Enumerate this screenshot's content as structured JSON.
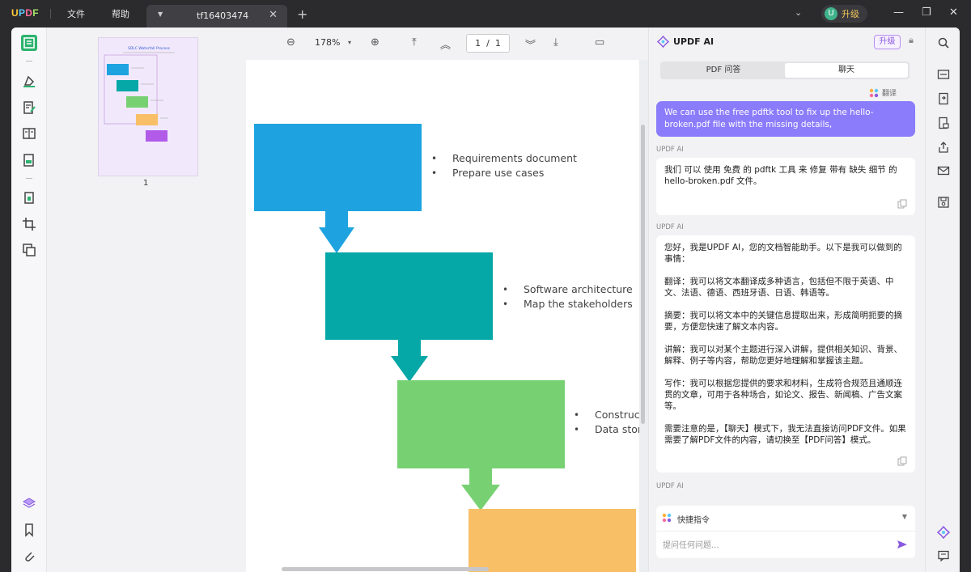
{
  "app": {
    "logo": "UPDF"
  },
  "menu": {
    "file": "文件",
    "help": "帮助"
  },
  "tab": {
    "title": "tf16403474"
  },
  "account": {
    "avatar_letter": "U",
    "upgrade": "升级"
  },
  "toolbar": {
    "zoom": "178%",
    "page_current": "1",
    "page_sep": "/",
    "page_total": "1"
  },
  "thumbnail": {
    "page_number": "1",
    "doc_title": "SDLC Waterfall Process"
  },
  "document": {
    "steps": [
      {
        "bullets": [
          "Requirements document",
          "Prepare use cases"
        ],
        "color": "#1ea3e0"
      },
      {
        "bullets": [
          "Software architecture",
          "Map the stakeholders"
        ],
        "color": "#06a7a7"
      },
      {
        "bullets": [
          "Construct",
          "Data stor"
        ],
        "color": "#77d173"
      },
      {
        "bullets": [],
        "color": "#f8bf67"
      }
    ]
  },
  "ai": {
    "title": "UPDF AI",
    "upgrade": "升级",
    "tabs": [
      {
        "label": "PDF 问答"
      },
      {
        "label": "聊天"
      }
    ],
    "translate": "翻译",
    "user_message": "We can use the free pdftk tool to fix up the hello-broken.pdf file with the missing details,",
    "label": "UPDF AI",
    "reply1": "我们 可以 使用 免费 的 pdftk 工具 来 修复 带有 缺失 细节 的 hello-broken.pdf 文件。",
    "reply2": [
      "您好，我是UPDF AI，您的文档智能助手。以下是我可以做到的事情：",
      "翻译：我可以将文本翻译成多种语言，包括但不限于英语、中文、法语、德语、西班牙语、日语、韩语等。",
      "摘要：我可以将文本中的关键信息提取出来，形成简明扼要的摘要，方便您快速了解文本内容。",
      "讲解：我可以对某个主题进行深入讲解，提供相关知识、背景、解释、例子等内容，帮助您更好地理解和掌握该主题。",
      "写作：我可以根据您提供的要求和材料，生成符合规范且通顺连贯的文章，可用于各种场合，如论文、报告、新闻稿、广告文案等。",
      "需要注意的是，【聊天】模式下，我无法直接访问PDF文件。如果需要了解PDF文件的内容，请切换至【PDF问答】模式。"
    ],
    "quick_command": "快捷指令",
    "input_placeholder": "提问任何问题..."
  }
}
